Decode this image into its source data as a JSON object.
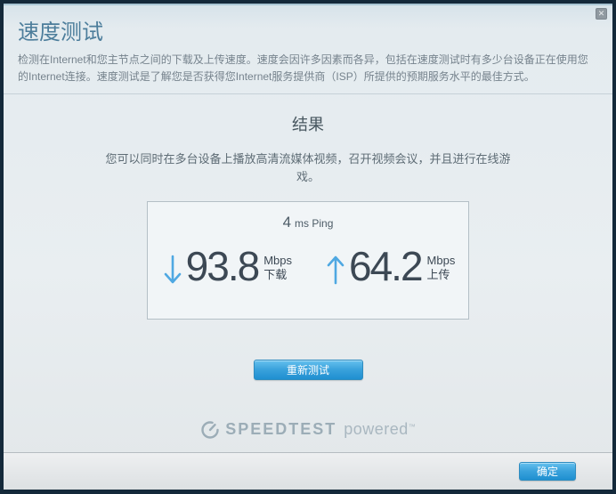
{
  "dialog": {
    "title": "速度测试",
    "description": "检测在Internet和您主节点之间的下载及上传速度。速度会因许多因素而各异，包括在速度测试时有多少台设备正在使用您的Internet连接。速度测试是了解您是否获得您Internet服务提供商（ISP）所提供的预期服务水平的最佳方式。"
  },
  "icons": {
    "close": "✕"
  },
  "results": {
    "heading": "结果",
    "summary": "您可以同时在多台设备上播放高清流媒体视频，召开视频会议，并且进行在线游戏。",
    "ping_value": "4",
    "ping_unit": "ms Ping",
    "download": {
      "value": "93.8",
      "unit": "Mbps",
      "label": "下载"
    },
    "upload": {
      "value": "64.2",
      "unit": "Mbps",
      "label": "上传"
    },
    "retest_label": "重新测试"
  },
  "branding": {
    "wordmark": "SPEEDTEST",
    "powered": "powered",
    "tm": "™"
  },
  "footer": {
    "ok_label": "确定"
  },
  "colors": {
    "frame": "#14293a",
    "accent_blue": "#4fa8e2",
    "button_top": "#66c1ee",
    "button_bottom": "#1f8fd0",
    "title": "#4c7d9b",
    "value_text": "#3c4854",
    "logo_gray": "#9cadb7"
  }
}
